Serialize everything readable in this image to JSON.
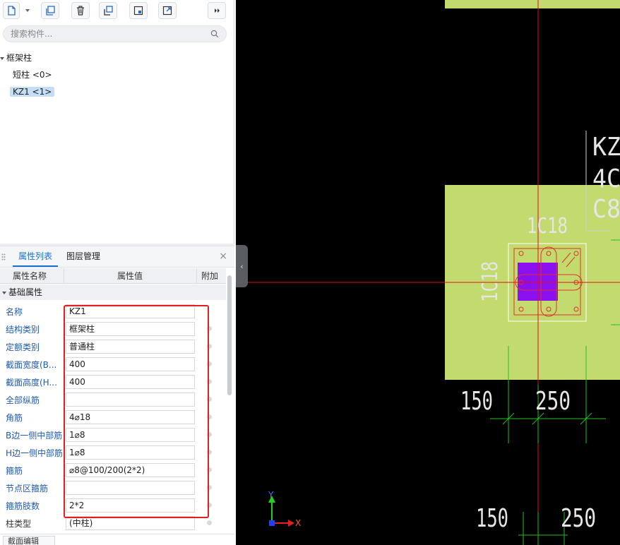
{
  "toolbar": {
    "buttons": [
      "new-icon",
      "dropdown-icon",
      "copy-icon",
      "delete-icon",
      "layer-copy-icon",
      "save-icon",
      "export-icon",
      "expand-icon"
    ]
  },
  "search": {
    "placeholder": "搜索构件..."
  },
  "tree": {
    "root": "框架柱",
    "items": [
      {
        "label": "短柱 <0>",
        "selected": false
      },
      {
        "label": "KZ1 <1>",
        "selected": true
      }
    ]
  },
  "tabs": {
    "active": "属性列表",
    "other": "图层管理",
    "close": "×"
  },
  "table": {
    "headers": {
      "name": "属性名称",
      "value": "属性值",
      "extra": "附加"
    },
    "group": "基础属性",
    "rows": [
      {
        "name": "名称",
        "value": "KZ1"
      },
      {
        "name": "结构类别",
        "value": "框架柱"
      },
      {
        "name": "定额类别",
        "value": "普通柱"
      },
      {
        "name": "截面宽度(B...",
        "value": "400"
      },
      {
        "name": "截面高度(H...",
        "value": "400"
      },
      {
        "name": "全部纵筋",
        "value": ""
      },
      {
        "name": "角筋",
        "value": "4⌀18"
      },
      {
        "name": "B边一侧中部筋",
        "value": "1⌀8"
      },
      {
        "name": "H边一侧中部筋",
        "value": "1⌀8"
      },
      {
        "name": "箍筋",
        "value": "⌀8@100/200(2*2)"
      },
      {
        "name": "节点区箍筋",
        "value": ""
      },
      {
        "name": "箍筋肢数",
        "value": "2*2"
      },
      {
        "name": "柱类型",
        "value": "(中柱)"
      }
    ]
  },
  "bottom_tab": "截面编辑",
  "canvas": {
    "column_label": "KZ",
    "label_line2": "4C",
    "label_line3": "C8",
    "top_rebar": "1C18",
    "side_rebar": "1C18",
    "dim_upper": [
      "150",
      "250"
    ],
    "dim_lower": [
      "150",
      "250"
    ],
    "axis_x": "X",
    "axis_y": "Y",
    "colors": {
      "column_fill": "#c3da6e",
      "section_fill": "#8a10f0",
      "axis_line": "#e01010",
      "dim_line": "#20c020",
      "rebar": "#e03030",
      "text": "#e6e6e6"
    }
  }
}
